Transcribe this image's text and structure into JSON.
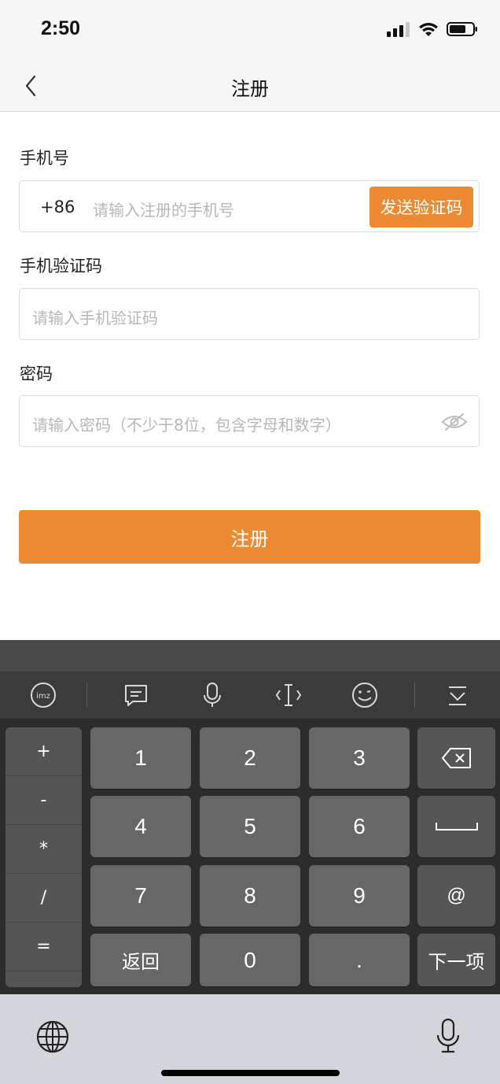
{
  "status_bar": {
    "time": "2:50",
    "icons": [
      "signal-icon",
      "wifi-icon",
      "battery-icon"
    ]
  },
  "nav": {
    "title": "注册",
    "back_icon": "chevron-left-icon"
  },
  "form": {
    "phone": {
      "label": "手机号",
      "country_code": "+86",
      "placeholder": "请输入注册的手机号",
      "send_code_label": "发送验证码"
    },
    "sms_code": {
      "label": "手机验证码",
      "placeholder": "请输入手机验证码"
    },
    "password": {
      "label": "密码",
      "placeholder": "请输入密码（不少于8位，包含字母和数字）",
      "toggle_icon": "eye-hidden-icon"
    },
    "submit_label": "注册"
  },
  "keyboard": {
    "toolbar_icons": [
      "ime-logo-icon",
      "clipboard-icon",
      "voice-icon",
      "cursor-icon",
      "emoji-icon",
      "collapse-keyboard-icon"
    ],
    "symbols": [
      "+",
      "-",
      "*",
      "/",
      "="
    ],
    "keys": {
      "k1": "1",
      "k2": "2",
      "k3": "3",
      "k4": "4",
      "k5": "5",
      "k6": "6",
      "k7": "7",
      "k8": "8",
      "k9": "9",
      "back": "返回",
      "k0": "0",
      "dot": ".",
      "at": "@",
      "next": "下一项"
    },
    "side_icons": [
      "backspace-icon",
      "space-icon"
    ]
  },
  "bottom_bar": {
    "icons": [
      "globe-icon",
      "microphone-icon"
    ]
  },
  "colors": {
    "accent": "#ec8a33",
    "keyboard_bg": "#2c2c2c",
    "key_bg": "#676767"
  }
}
